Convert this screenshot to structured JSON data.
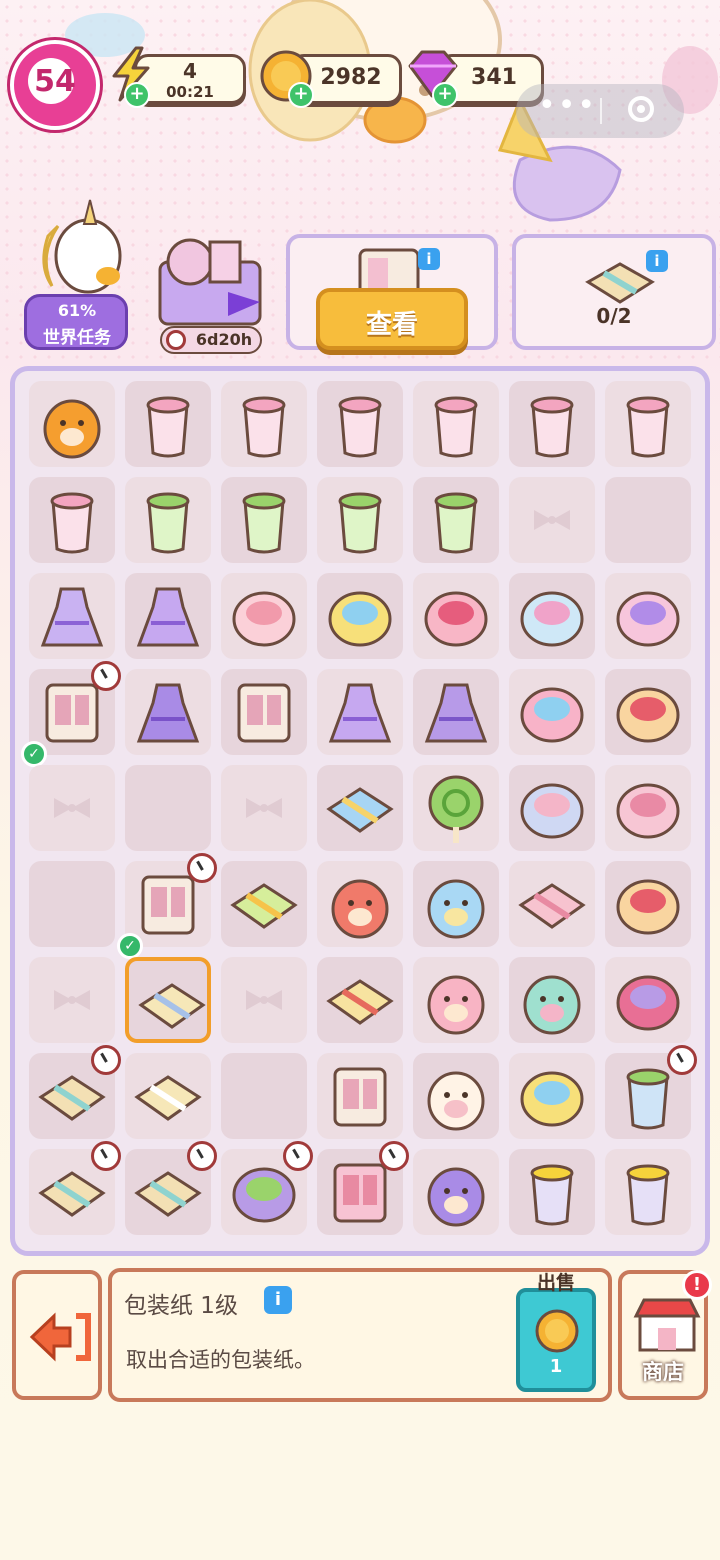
{
  "hud": {
    "level": "54",
    "energy": "4",
    "energy_timer": "00:21",
    "coins": "2982",
    "gems": "341"
  },
  "quest": {
    "progress": "61%",
    "label": "世界任务"
  },
  "event": {
    "timer": "6d20h"
  },
  "orders": {
    "view_button": "查看",
    "gift_progress": "0/2"
  },
  "info_panel": {
    "title": "包装纸 1级",
    "description": "取出合适的包装纸。",
    "sell_label": "出售",
    "sell_price": "1",
    "shop_label": "商店"
  },
  "colors": {
    "accent": "#f5b233",
    "board_border": "#c9b8ea",
    "panel_border": "#c8795a"
  }
}
